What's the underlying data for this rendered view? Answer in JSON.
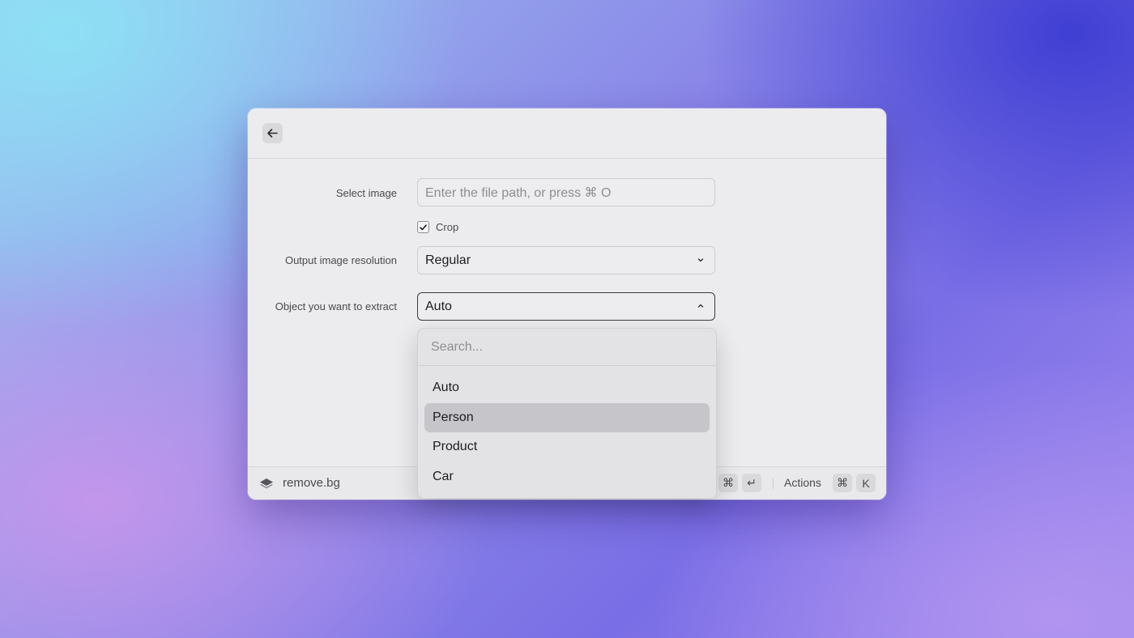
{
  "window": {
    "back_icon": "arrow-left-icon"
  },
  "form": {
    "select_image": {
      "label": "Select image",
      "placeholder": "Enter the file path, or press ⌘ O"
    },
    "crop": {
      "label": "Crop",
      "checked": true
    },
    "resolution": {
      "label": "Output image resolution",
      "value": "Regular"
    },
    "object": {
      "label": "Object you want to extract",
      "value": "Auto"
    }
  },
  "dropdown": {
    "search_placeholder": "Search...",
    "options": [
      "Auto",
      "Person",
      "Product",
      "Car"
    ],
    "highlighted": "Person"
  },
  "footer": {
    "brand": "remove.bg",
    "submit_keys": [
      "⌘",
      "↵"
    ],
    "actions_label": "Actions",
    "actions_keys": [
      "⌘",
      "K"
    ]
  }
}
